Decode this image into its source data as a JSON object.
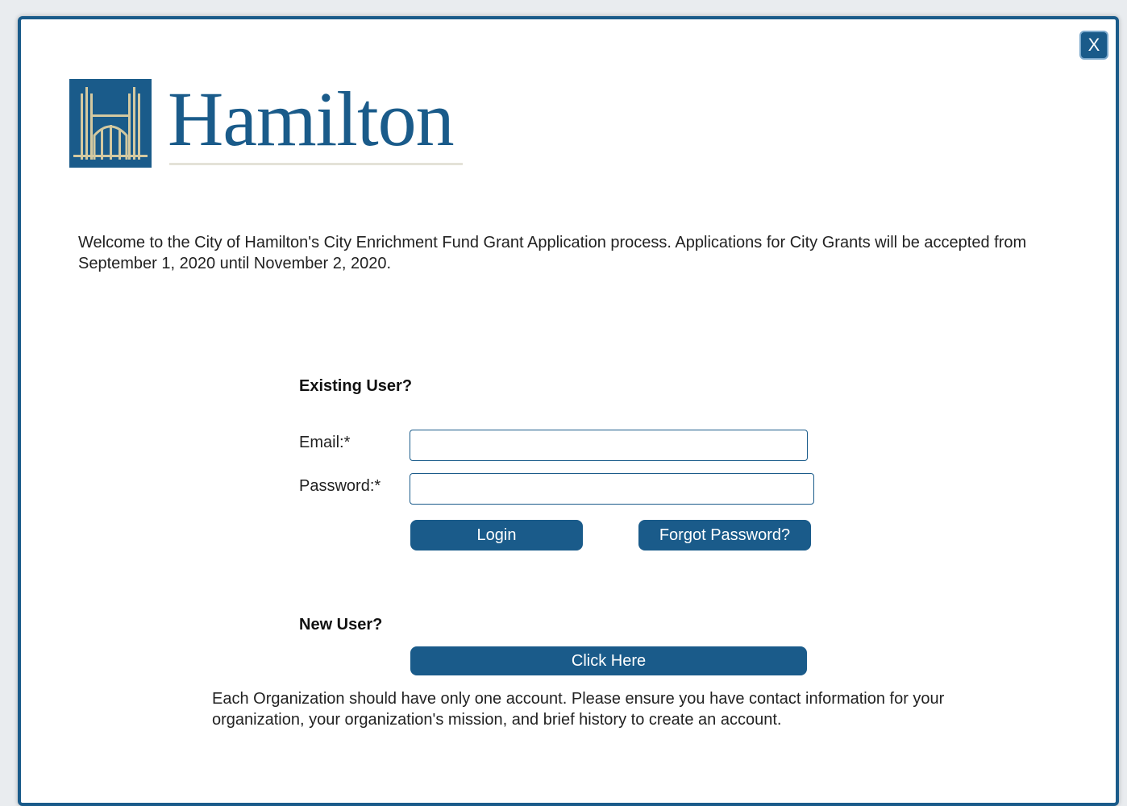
{
  "dialog": {
    "close_label": "X"
  },
  "logo": {
    "text": "Hamilton",
    "color": "#1a5b8a",
    "accent": "#d4c9a0"
  },
  "welcome_text": "Welcome to the City of Hamilton's City Enrichment Fund Grant Application process. Applications for City Grants will be accepted from September 1, 2020 until November 2, 2020.",
  "existing_user": {
    "heading": "Existing User?",
    "email_label": "Email:*",
    "email_value": "",
    "password_label": "Password:*",
    "password_value": "",
    "login_label": "Login",
    "forgot_label": "Forgot Password?"
  },
  "new_user": {
    "heading": "New User?",
    "click_here_label": "Click Here",
    "note": "Each Organization should have only one account. Please ensure you have contact information for your organization, your organization's mission, and brief history to create an account."
  },
  "colors": {
    "primary": "#1a5b8a",
    "background": "#ffffff"
  }
}
